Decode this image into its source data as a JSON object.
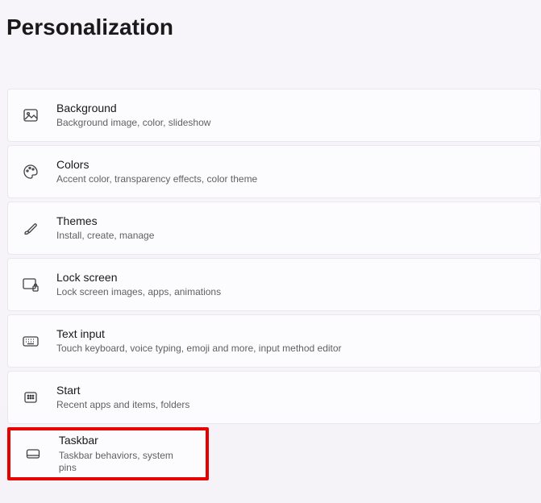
{
  "page": {
    "title": "Personalization"
  },
  "items": [
    {
      "icon": "picture-icon",
      "title": "Background",
      "desc": "Background image, color, slideshow"
    },
    {
      "icon": "palette-icon",
      "title": "Colors",
      "desc": "Accent color, transparency effects, color theme"
    },
    {
      "icon": "brush-icon",
      "title": "Themes",
      "desc": "Install, create, manage"
    },
    {
      "icon": "lockscreen-icon",
      "title": "Lock screen",
      "desc": "Lock screen images, apps, animations"
    },
    {
      "icon": "keyboard-icon",
      "title": "Text input",
      "desc": "Touch keyboard, voice typing, emoji and more, input method editor"
    },
    {
      "icon": "start-icon",
      "title": "Start",
      "desc": "Recent apps and items, folders"
    },
    {
      "icon": "taskbar-icon",
      "title": "Taskbar",
      "desc": "Taskbar behaviors, system pins"
    }
  ]
}
